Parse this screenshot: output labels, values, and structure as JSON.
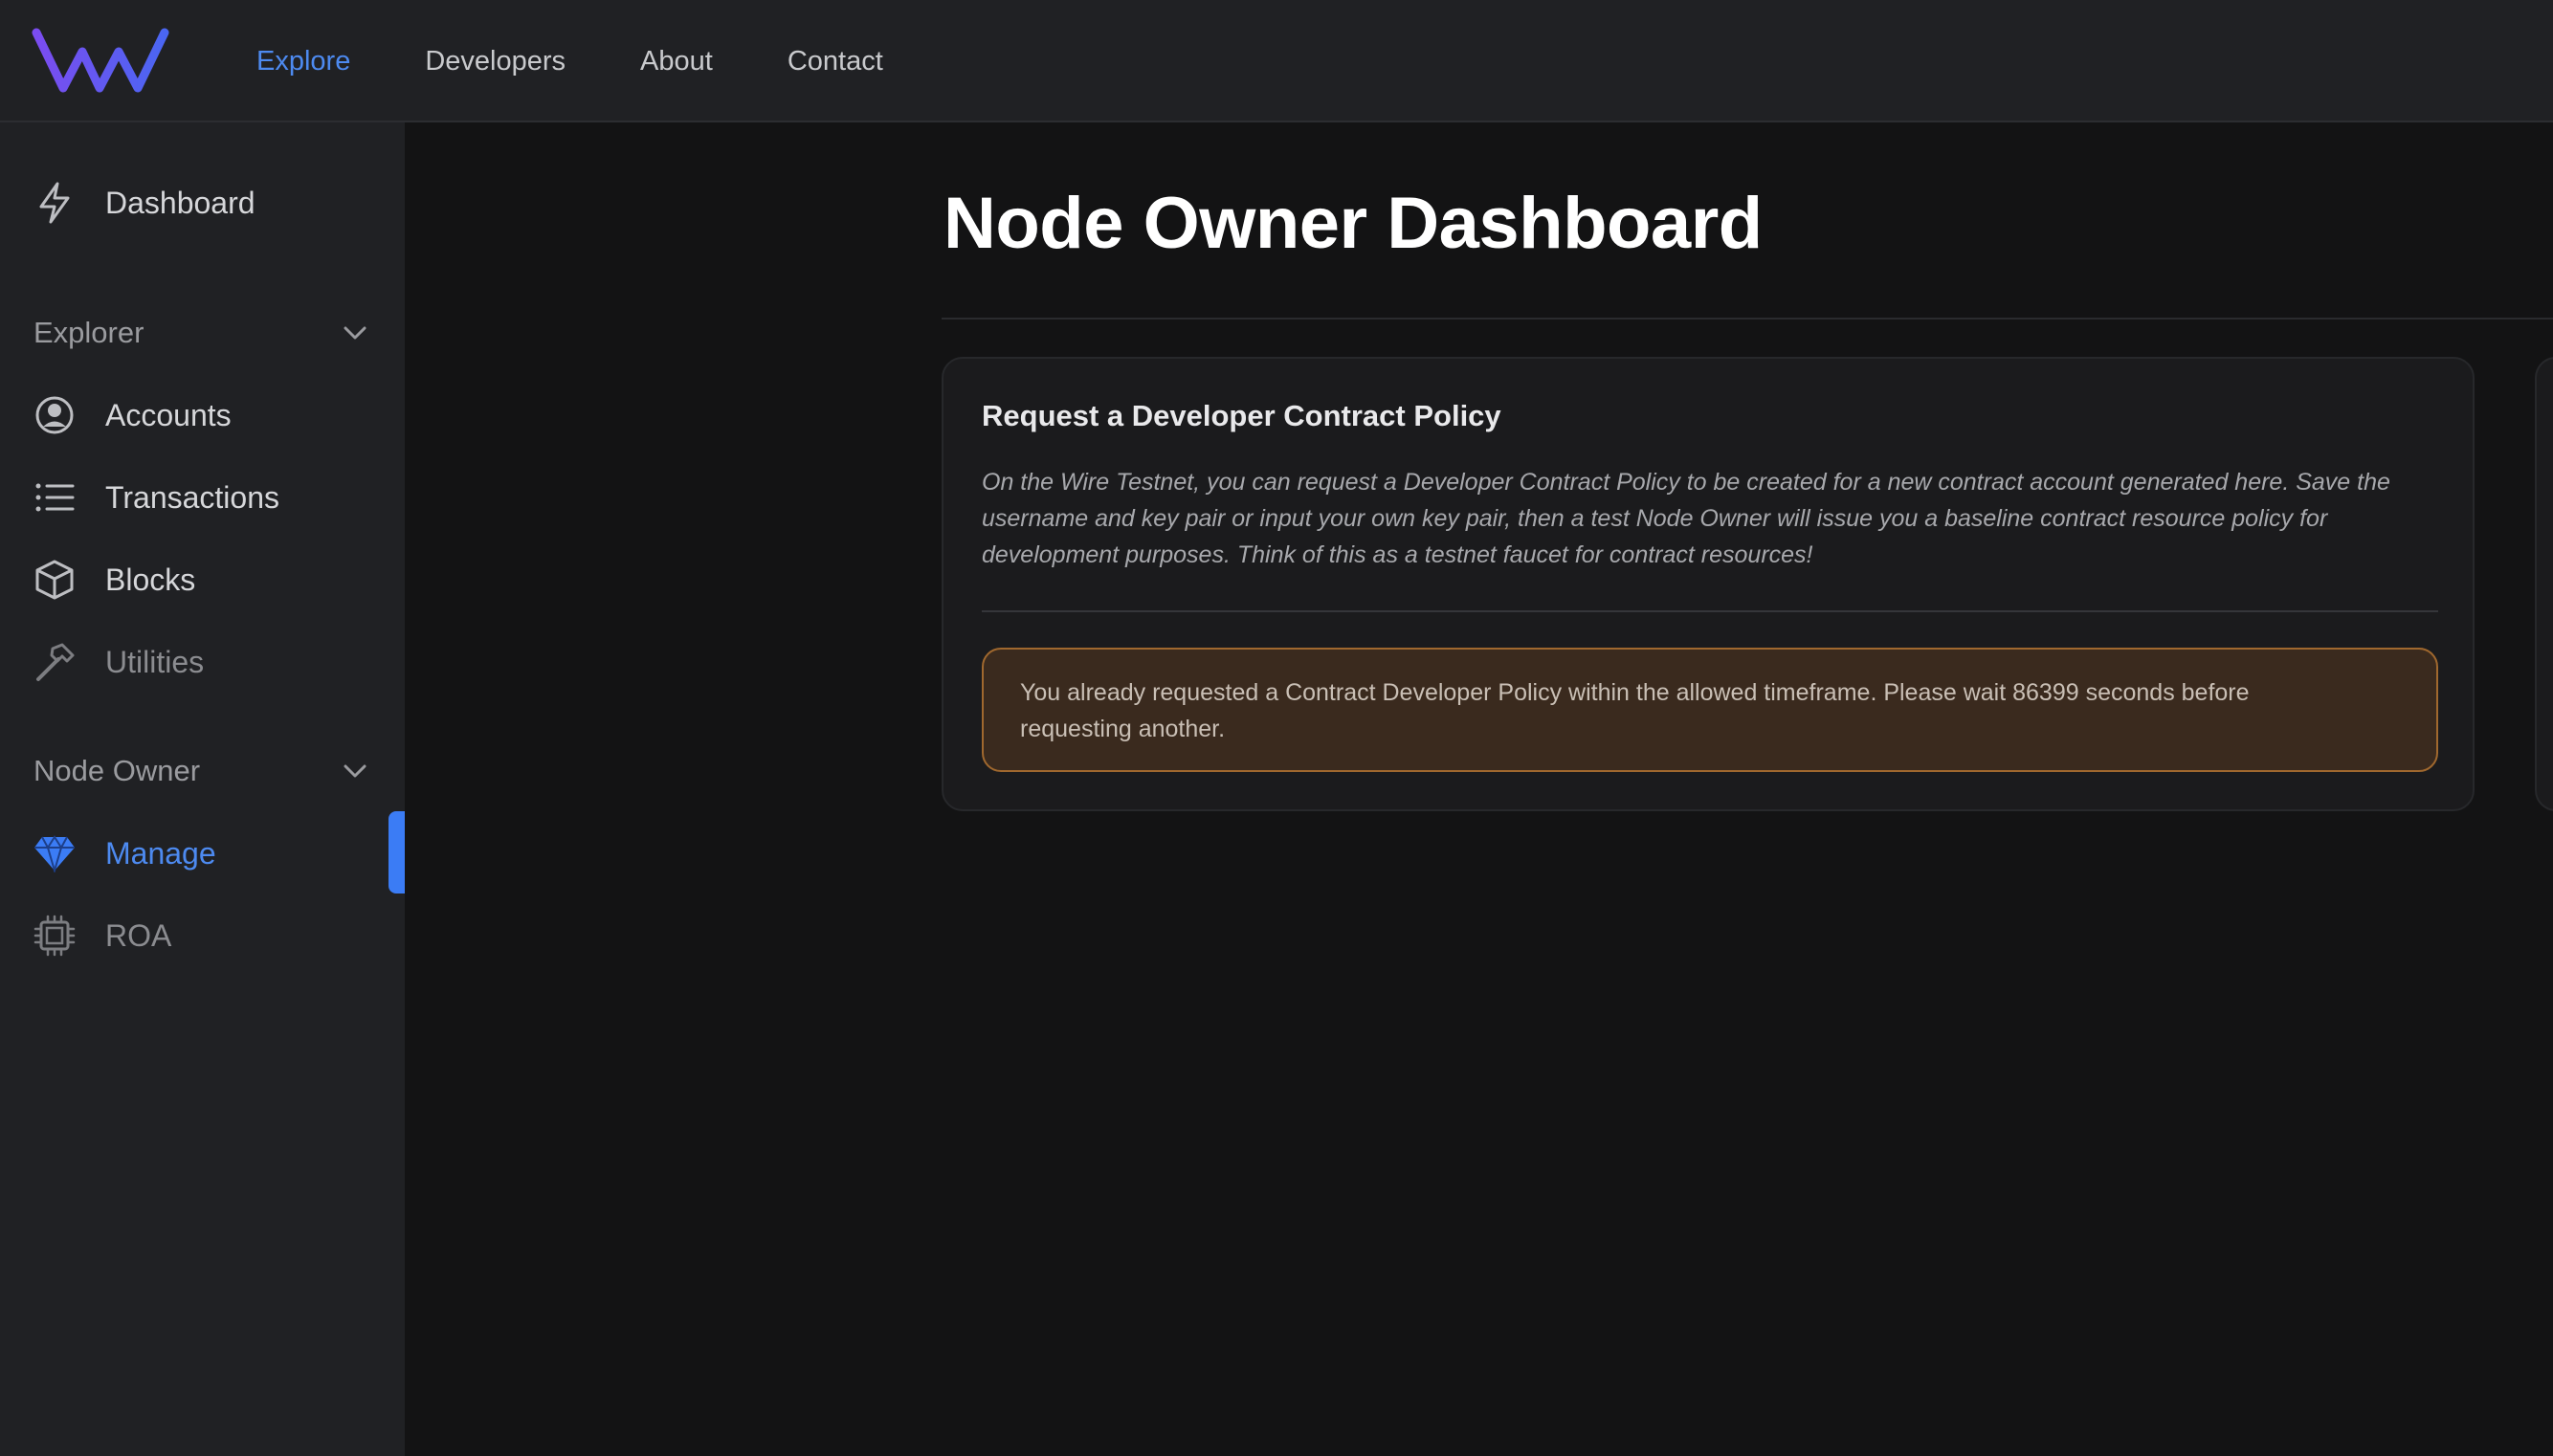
{
  "topbar": {
    "logo": "wire-logo",
    "nav": [
      {
        "label": "Explore",
        "active": true
      },
      {
        "label": "Developers",
        "active": false
      },
      {
        "label": "About",
        "active": false
      },
      {
        "label": "Contact",
        "active": false
      }
    ]
  },
  "sidebar": {
    "dashboard": {
      "label": "Dashboard",
      "icon": "lightning-icon"
    },
    "explorer_section": {
      "label": "Explorer"
    },
    "explorer_items": [
      {
        "label": "Accounts",
        "icon": "user-circle-icon"
      },
      {
        "label": "Transactions",
        "icon": "list-icon"
      },
      {
        "label": "Blocks",
        "icon": "cube-icon"
      },
      {
        "label": "Utilities",
        "icon": "hammer-icon"
      }
    ],
    "node_owner_section": {
      "label": "Node Owner"
    },
    "node_owner_items": [
      {
        "label": "Manage",
        "icon": "diamond-icon",
        "active": true
      },
      {
        "label": "ROA",
        "icon": "cpu-icon"
      }
    ]
  },
  "main": {
    "title": "Node Owner Dashboard",
    "card": {
      "title": "Request a Developer Contract Policy",
      "description": "On the Wire Testnet, you can request a Developer Contract Policy to be created for a new contract account generated here. Save the username and key pair or input your own key pair, then a test Node Owner will issue you a baseline contract resource policy for development purposes. Think of this as a testnet faucet for contract resources!",
      "alert": "You already requested a Contract Developer Policy within the allowed timeframe. Please wait 86399 seconds before requesting another."
    }
  },
  "colors": {
    "accent": "#4d8af0",
    "alert_border": "#a0682e",
    "alert_bg": "#3a2a1e"
  }
}
